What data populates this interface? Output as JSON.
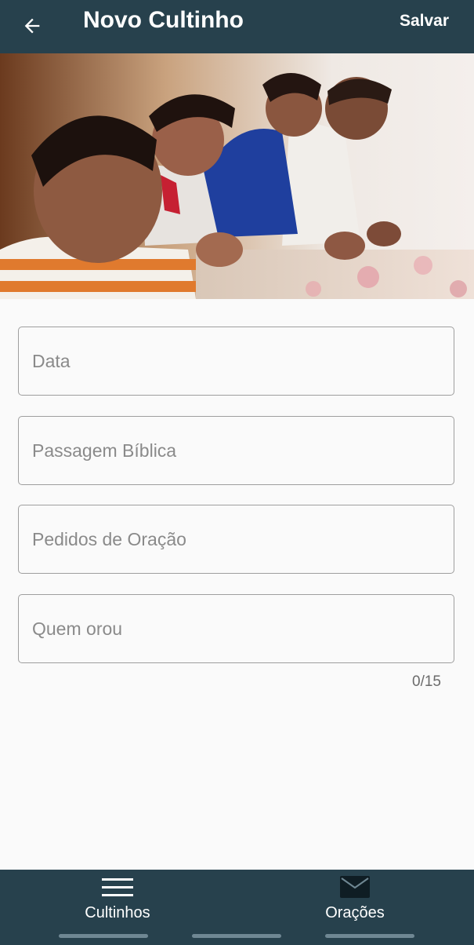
{
  "appbar": {
    "title": "Novo Cultinho",
    "save_label": "Salvar",
    "back_icon": "arrow-left-icon",
    "background": "#27414d"
  },
  "form": {
    "date_placeholder": "Data",
    "passage_placeholder": "Passagem Bíblica",
    "requests_placeholder": "Pedidos de Oração",
    "who_prayed_placeholder": "Quem orou",
    "who_prayed_counter": "0/15"
  },
  "bottom_nav": {
    "items": [
      {
        "label": "Cultinhos",
        "icon": "menu-icon"
      },
      {
        "label": "Orações",
        "icon": "mail-icon"
      }
    ]
  }
}
